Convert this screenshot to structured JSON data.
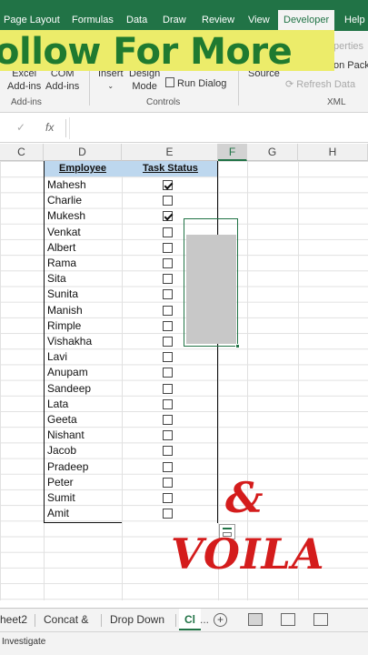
{
  "ribbon_tabs": [
    "Page Layout",
    "Formulas",
    "Data",
    "Draw",
    "Review",
    "View",
    "Developer",
    "Help"
  ],
  "active_tab": "Developer",
  "banner_text": "ollow For More",
  "ribbon": {
    "excel_addins": [
      "Excel",
      "Add-ins"
    ],
    "com_addins": [
      "COM",
      "Add-ins"
    ],
    "addins_group": "Add-ins",
    "insert": "Insert",
    "design_mode": [
      "Design",
      "Mode"
    ],
    "run_dialog": "Run Dialog",
    "controls_group": "Controls",
    "source": "Source",
    "properties": "perties",
    "expansion_packs": "on Packs",
    "refresh_data": "Refresh Data",
    "xml_group": "XML"
  },
  "formula_bar": {
    "fx": "fx",
    "check": "✓"
  },
  "columns": [
    "C",
    "D",
    "E",
    "F",
    "G",
    "H"
  ],
  "table": {
    "header_employee": "Employee",
    "header_status": "Task Status",
    "rows": [
      {
        "name": "Mahesh",
        "checked": true
      },
      {
        "name": "Charlie",
        "checked": false
      },
      {
        "name": "Mukesh",
        "checked": true
      },
      {
        "name": "Venkat",
        "checked": false
      },
      {
        "name": "Albert",
        "checked": false
      },
      {
        "name": "Rama",
        "checked": false
      },
      {
        "name": "Sita",
        "checked": false
      },
      {
        "name": "Sunita",
        "checked": false
      },
      {
        "name": "Manish",
        "checked": false
      },
      {
        "name": "Rimple",
        "checked": false
      },
      {
        "name": "Vishakha",
        "checked": false
      },
      {
        "name": "Lavi",
        "checked": false
      },
      {
        "name": "Anupam",
        "checked": false
      },
      {
        "name": "Sandeep",
        "checked": false
      },
      {
        "name": "Lata",
        "checked": false
      },
      {
        "name": "Geeta",
        "checked": false
      },
      {
        "name": "Nishant",
        "checked": false
      },
      {
        "name": "Jacob",
        "checked": false
      },
      {
        "name": "Pradeep",
        "checked": false
      },
      {
        "name": "Peter",
        "checked": false
      },
      {
        "name": "Sumit",
        "checked": false
      },
      {
        "name": "Amit",
        "checked": false
      }
    ]
  },
  "overlay": {
    "amp": "&",
    "voila": "VOILA"
  },
  "sheet_tabs": [
    "heet2",
    "Concat &",
    "Drop Down",
    "Cl"
  ],
  "sheet_more": "...",
  "status_text": "Investigate",
  "colors": {
    "excel_green": "#217346",
    "header_fill": "#bdd7ee",
    "overlay_red": "#d41c1c",
    "banner_yellow": "#ecec6a",
    "banner_green": "#1f7a30"
  }
}
